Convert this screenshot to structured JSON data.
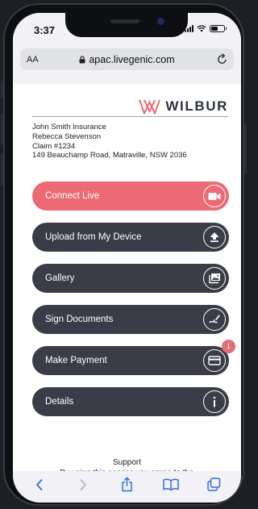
{
  "status_bar": {
    "time": "3:37"
  },
  "browser": {
    "text_size_label": "AA",
    "url": "apac.livegenic.com"
  },
  "brand": {
    "name": "WILBUR",
    "accent_color": "#ec6a73"
  },
  "address_lines": [
    "John Smith Insurance",
    "Rebecca Stevenson",
    "Claim #1234",
    "149 Beauchamp Road, Matraville, NSW 2036"
  ],
  "actions": {
    "connect_live": {
      "label": "Connect Live",
      "icon": "video-camera-icon"
    },
    "upload": {
      "label": "Upload from My Device",
      "icon": "upload-icon"
    },
    "gallery": {
      "label": "Gallery",
      "icon": "image-gallery-icon"
    },
    "sign": {
      "label": "Sign Documents",
      "icon": "signature-icon"
    },
    "payment": {
      "label": "Make Payment",
      "icon": "credit-card-icon",
      "badge": "1"
    },
    "details": {
      "label": "Details",
      "icon": "info-icon"
    }
  },
  "footer": {
    "support_label": "Support",
    "terms_text": "By using this service you agree to the"
  },
  "toolbar_icons": [
    "back-icon",
    "forward-icon",
    "share-icon",
    "bookmarks-icon",
    "tabs-icon"
  ]
}
